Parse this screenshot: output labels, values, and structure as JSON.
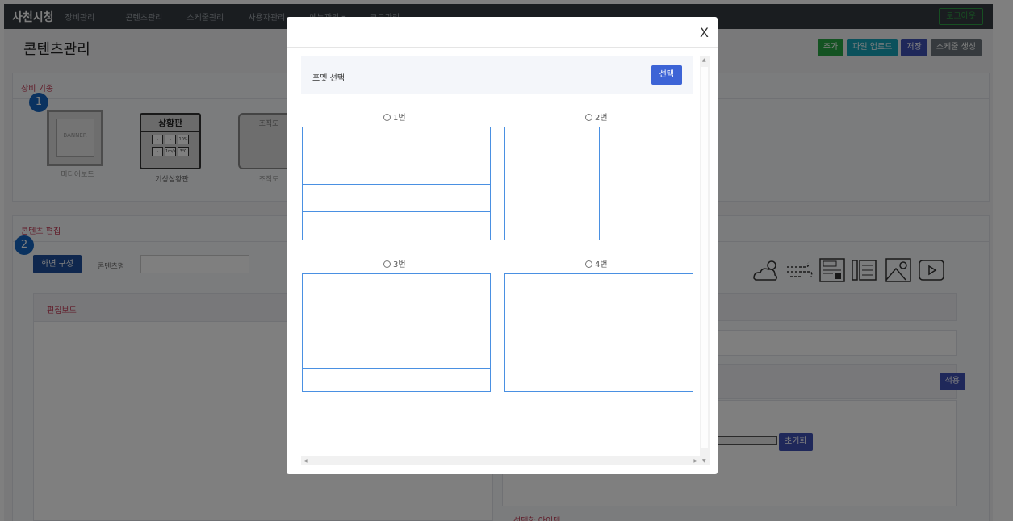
{
  "navbar": {
    "brand": "사천시청",
    "items": [
      "장비관리",
      "콘텐츠관리",
      "스케줄관리",
      "사용자관리",
      "메뉴관리 ▾",
      "코드관리"
    ],
    "logout_label": "로그아웃"
  },
  "page": {
    "title": "콘텐츠관리",
    "actions": [
      "추가",
      "파일 업로드",
      "저장",
      "스케줄 생성"
    ]
  },
  "device_section": {
    "heading": "장비 기종",
    "badge": "1",
    "devices": [
      {
        "label": "미디어보드",
        "banner_text": "BANNER"
      },
      {
        "label": "기상상황판",
        "title": "상황판",
        "cells": [
          "-",
          "-",
          "10%",
          "-",
          "1m/s",
          "3℃"
        ]
      },
      {
        "label": "조직도",
        "title": "조직도"
      }
    ]
  },
  "edit_section": {
    "heading": "콘텐츠 편집",
    "badge": "2",
    "screen_button": "화면 구성",
    "content_name_label": "콘텐츠명 :",
    "content_name_value": "",
    "board_heading": "편집보드",
    "apply_button": "적용",
    "reset_button": "초기화",
    "selected_item_heading": "선택한 아이템"
  },
  "tool_icons": [
    "weather-icon",
    "wind-icon",
    "news-icon",
    "notice-icon",
    "image-icon",
    "video-icon"
  ],
  "modal": {
    "close_label": "X",
    "format_title": "포멧 선택",
    "select_button": "선택",
    "options": [
      {
        "label": "1번",
        "rows": 4,
        "cols": 1
      },
      {
        "label": "2번",
        "rows": 1,
        "cols": 2
      },
      {
        "label": "3번",
        "split": [
          0.8,
          0.2
        ]
      },
      {
        "label": "4번",
        "rows": 1,
        "cols": 1
      }
    ]
  },
  "colors": {
    "navbar": "#343a40",
    "accent_blue": "#3d64d6",
    "heading_red": "#c23b55",
    "layout_line": "#4a90e2",
    "badge": "#1565c0"
  }
}
